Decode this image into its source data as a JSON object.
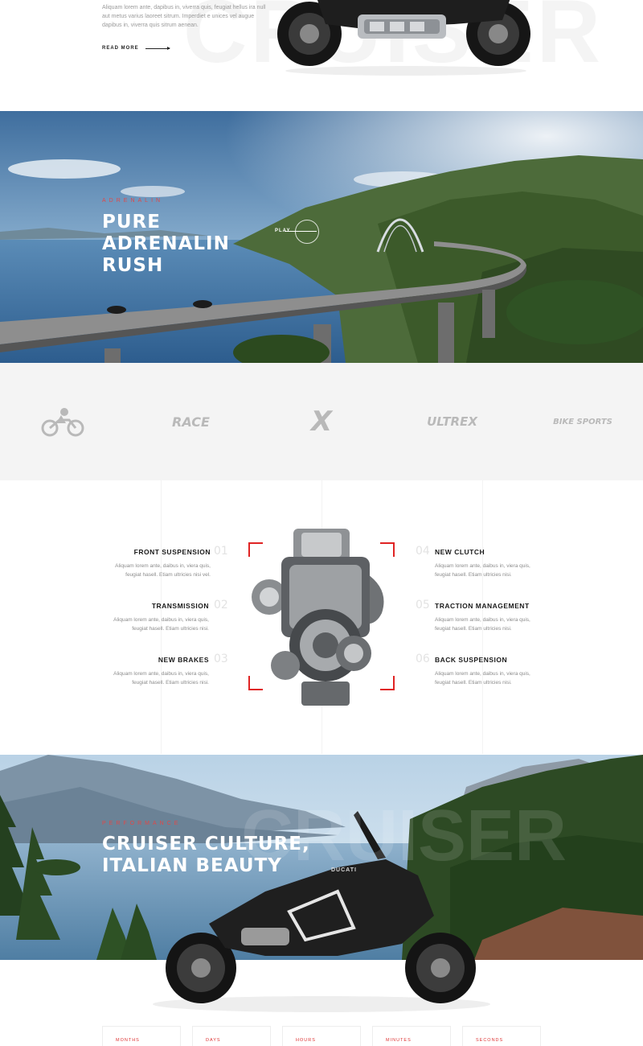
{
  "intro": {
    "text": "Aliquam lorem ante, dapibus in, viverra quis, feugiat hellus ira null aut metus varius laoreet sitrum. Imperdiet e unices vel augue dapibus in, viverra quis sitrum aenean.",
    "read_more": "READ MORE",
    "watermark": "CRUISER"
  },
  "adrenalin": {
    "kicker": "ADRENALIN",
    "title_line1": "PURE",
    "title_line2": "ADRENALIN",
    "title_line3": "RUSH",
    "play_label": "PLAY"
  },
  "brands": [
    {
      "name": "moto-rider-logo",
      "label": ""
    },
    {
      "name": "race-logo",
      "label": "RACE"
    },
    {
      "name": "x-logo",
      "label": "X"
    },
    {
      "name": "ultrex-logo",
      "label": "ULTREX"
    },
    {
      "name": "bike-sports-logo",
      "label": "BIKE SPORTS"
    }
  ],
  "features": {
    "left": [
      {
        "title": "FRONT SUSPENSION",
        "num": "01",
        "desc1": "Aliquam lorem ante, daibus in, viera quis,",
        "desc2": "feugiat hasell. Etiam ultricies nisi vel."
      },
      {
        "title": "TRANSMISSION",
        "num": "02",
        "desc1": "Aliquam lorem ante, daibus in, viera quis,",
        "desc2": "feugiat hasell. Etiam ultricies nisi."
      },
      {
        "title": "NEW BRAKES",
        "num": "03",
        "desc1": "Aliquam lorem ante, daibus in, viera quis,",
        "desc2": "feugiat hasell. Etiam ultricies nisi."
      }
    ],
    "right": [
      {
        "title": "NEW CLUTCH",
        "num": "04",
        "desc1": "Aliquam lorem ante, daibus in, viera quis,",
        "desc2": "feugiat hasell. Etiam ultricies nisi."
      },
      {
        "title": "TRACTION MANAGEMENT",
        "num": "05",
        "desc1": "Aliquam lorem ante, daibus in, viera quis,",
        "desc2": "feugiat hasell. Etiam ultricies nisi."
      },
      {
        "title": "BACK SUSPENSION",
        "num": "06",
        "desc1": "Aliquam lorem ante, daibus in, viera quis,",
        "desc2": "feugiat hasell. Etiam ultricies nisi."
      }
    ]
  },
  "performance": {
    "kicker": "PERFORMANCE",
    "title_line1": "CRUISER CULTURE,",
    "title_line2": "ITALIAN BEAUTY",
    "watermark": "CRUISER",
    "bike_brand": "DUCATI"
  },
  "countdown": {
    "months": "MONTHS",
    "days": "DAYS",
    "hours": "HOURS",
    "minutes": "MINUTES",
    "seconds": "SECONDS"
  },
  "colors": {
    "accent": "#e02424",
    "brand_grey": "#b9b9b9"
  }
}
